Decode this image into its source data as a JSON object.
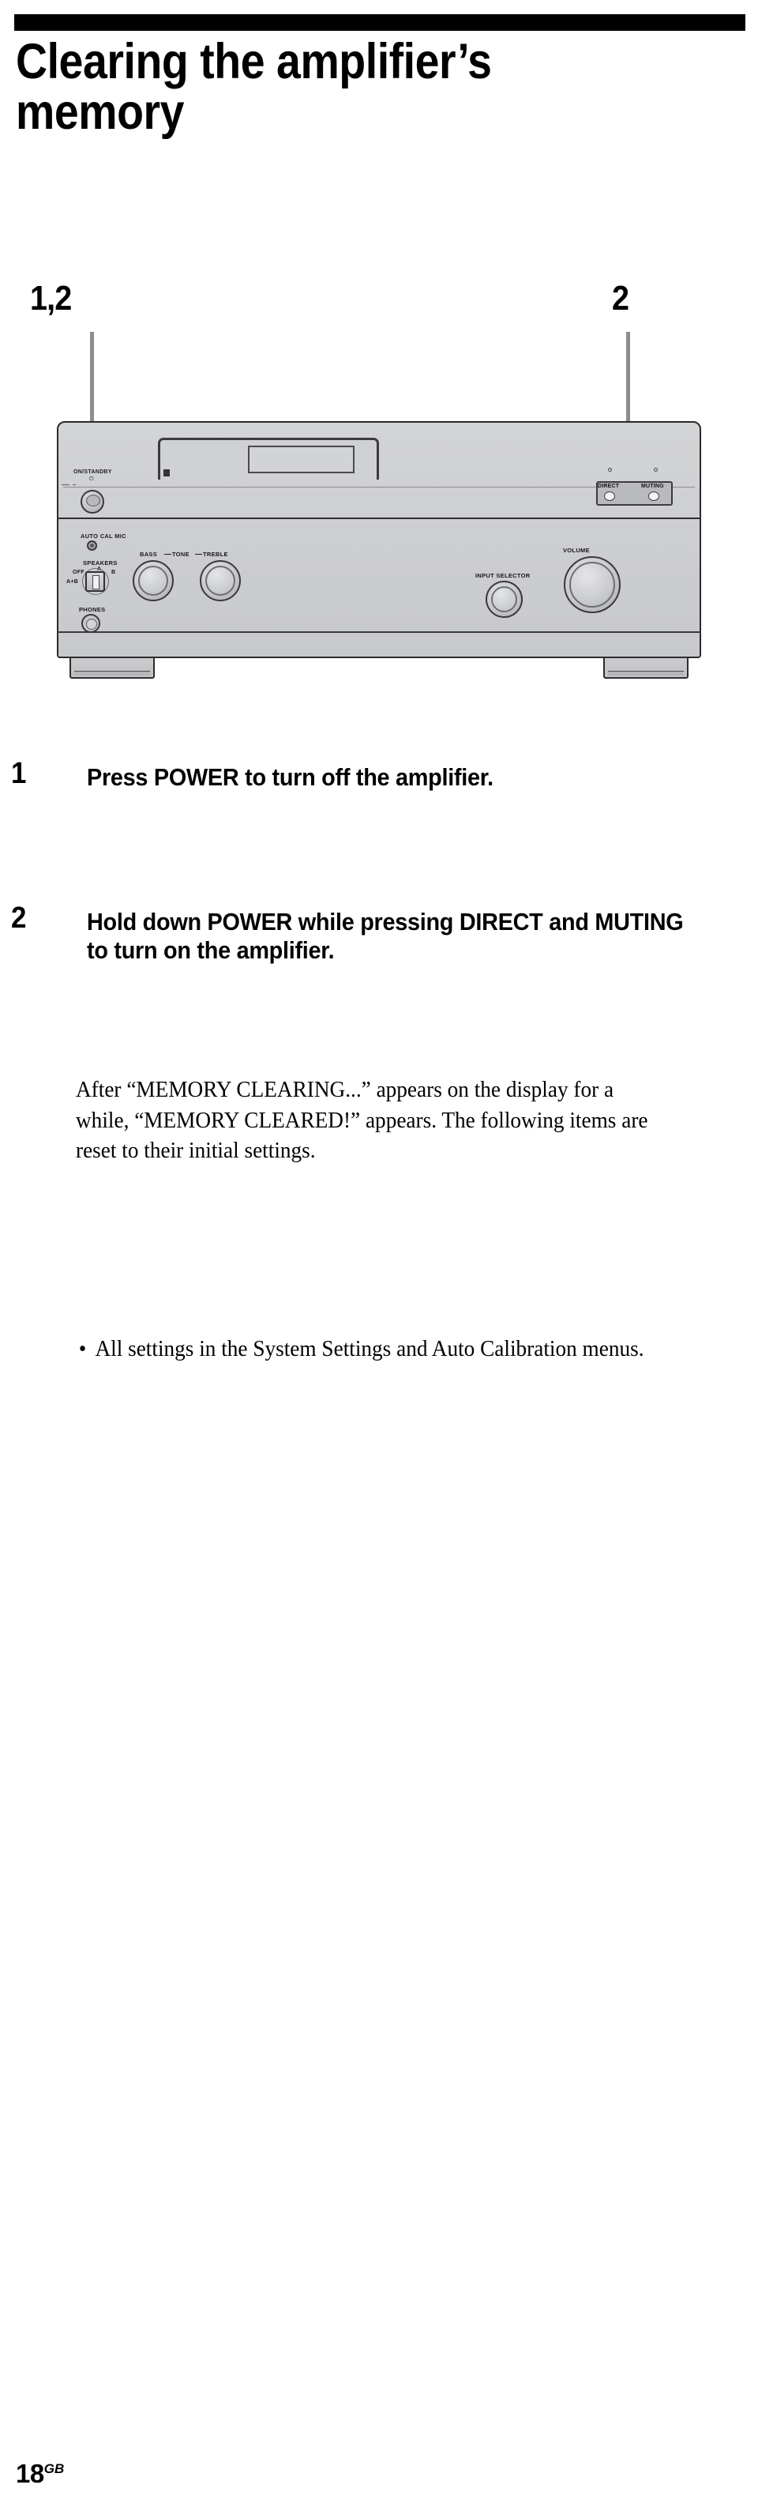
{
  "document": {
    "chapter_title": "Clearing the amplifier’s\nmemory",
    "page_number": "18",
    "page_region_code": "GB"
  },
  "callouts": [
    {
      "label": "1,2",
      "points_to": "power-button"
    },
    {
      "label": "2",
      "points_to": "direct-and-muting-buttons"
    }
  ],
  "steps": [
    {
      "number": "1",
      "text": "Press POWER to turn off the amplifier."
    },
    {
      "number": "2",
      "text": "Hold down POWER while pressing DIRECT and MUTING to turn on the amplifier."
    }
  ],
  "body": {
    "paragraph_1": "After “MEMORY CLEARING...” appears on the display for a while, “MEMORY CLEARED!” appears. The following items are reset to their initial settings.",
    "bullets": [
      {
        "marker": "•",
        "text": "All settings in the System Settings and Auto Calibration menus."
      }
    ]
  },
  "amplifier": {
    "front_panel_labels": {
      "on_standby": "ON/STANDBY",
      "on_standby_symbol": "⏻",
      "auto_cal_mic": "AUTO CAL MIC",
      "speakers": "SPEAKERS",
      "speakers_off": "OFF",
      "speakers_a": "A",
      "speakers_b": "B",
      "speakers_a_plus_b": "A+B",
      "bass": "BASS",
      "tone": "TONE",
      "treble": "TREBLE",
      "phones": "PHONES",
      "input_selector": "INPUT SELECTOR",
      "volume": "VOLUME",
      "direct": "DIRECT",
      "muting": "MUTING"
    }
  },
  "colors": {
    "rule": "#000000",
    "chassis_light": "#d3d4d6",
    "chassis_dark": "#c8c9cc",
    "outline": "#2a2a2c",
    "leader_line": "#8d8d8d",
    "text": "#000000"
  }
}
